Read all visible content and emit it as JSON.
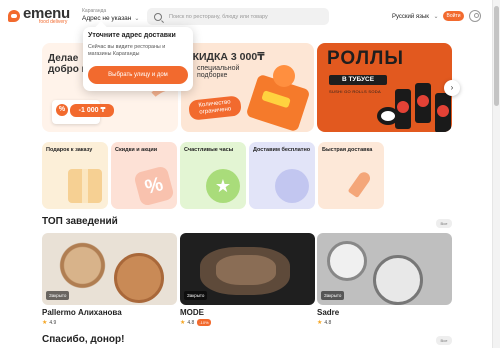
{
  "header": {
    "logo_name": "emenu",
    "logo_sub": "food delivery",
    "city": "Караганда",
    "address": "Адрес не указан",
    "search_placeholder": "Поиск по ресторану, блюду или товару",
    "language": "Русский язык",
    "login": "Войти"
  },
  "popup": {
    "title": "Уточните адрес доставки",
    "text": "Сейчас вы видите рестораны и магазины Караганды",
    "button": "Выбрать улицу и дом"
  },
  "banners": {
    "b1_title": "Делае\nдобро в",
    "b1_price": "-1 000 ₸",
    "b1_pct": "%",
    "b2_title": "СКИДКА 3 000₸",
    "b2_sub": "специальной\nподборке",
    "b2_badge": "Количество\nограничено",
    "b3_title": "РОЛЛЫ",
    "b3_sub": "В ТУБУСЕ",
    "b3_tag": "SUSHI GO ROLLS SODA"
  },
  "categories": [
    {
      "label": "Подарок к заказу"
    },
    {
      "label": "Скидки и акции"
    },
    {
      "label": "Счастливые часы"
    },
    {
      "label": "Доставим бесплатно"
    },
    {
      "label": "Быстрая доставка"
    }
  ],
  "sections": {
    "top_title": "ТОП заведений",
    "all_label": "Все",
    "thanks_title": "Спасибо, донор!"
  },
  "restaurants": [
    {
      "name": "Pallermo Алиханова",
      "rating": "4.9",
      "status": "Закрыто",
      "promo": ""
    },
    {
      "name": "MODE",
      "rating": "4.8",
      "status": "Закрыто",
      "promo": "-10%"
    },
    {
      "name": "Sadre",
      "rating": "4.8",
      "status": "Закрыто",
      "promo": ""
    }
  ],
  "colors": {
    "accent": "#f26a2e"
  }
}
